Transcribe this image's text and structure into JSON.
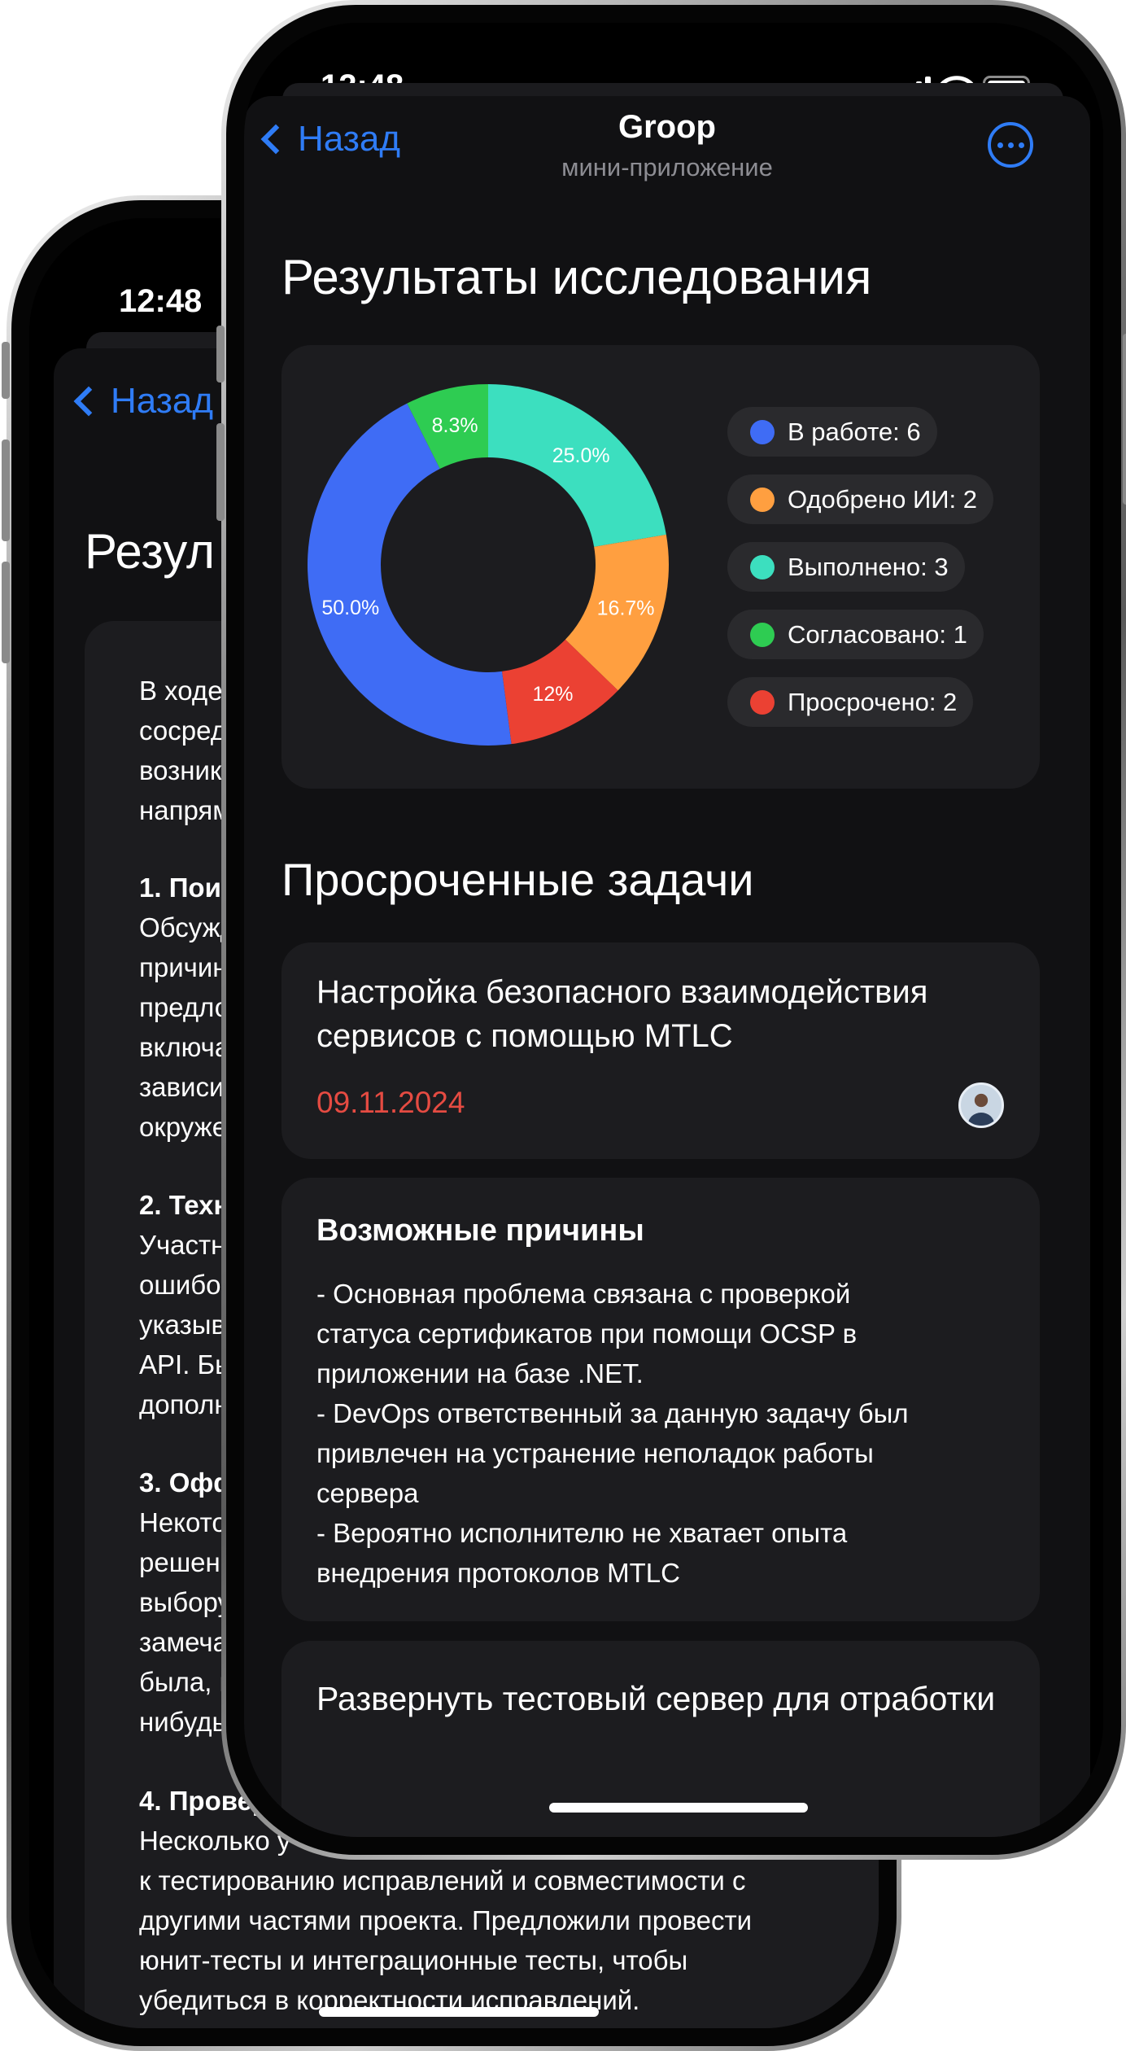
{
  "back_phone": {
    "status_time": "12:48",
    "nav_back_label": "Назад",
    "title_fragment": "Резул",
    "body_lines": {
      "intro": "В ходе о\nсосредо\nвозникл\nнапряму",
      "p1_head": "1. Поиск",
      "p1_body": "Обсужд\nпричина\nпредлож\nвключая\nзависим\nокружен",
      "p2_head": "2. Техни",
      "p2_body": "Участни\nошибок,\nуказыва\nAPI. Был\nдополни",
      "p3_head": "3. Оффт",
      "p3_body": "Некотор\nрешения\nвыбору т\nзамечан\nбыла, но\nнибудь в",
      "p4_head": "4. Провер",
      "p4_body_first": "Несколько у",
      "p4_body_rest": "к тестированию исправлений и совместимости с\nдругими частями проекта. Предложили провести\nюнит-тесты и интеграционные тесты, чтобы\nубедиться в корректности исправлений."
    }
  },
  "front_phone": {
    "status_time": "12:48",
    "nav": {
      "back_label": "Назад",
      "title": "Groop",
      "subtitle": "мини-приложение"
    },
    "results_title": "Результаты исследования",
    "overdue_title": "Просроченные задачи",
    "legend": [
      {
        "label": "В работе: 6",
        "color": "#3f6cf5"
      },
      {
        "label": "Одобрено ИИ: 2",
        "color": "#ff9f40"
      },
      {
        "label": "Выполнено: 3",
        "color": "#3cdfbf"
      },
      {
        "label": "Согласовано: 1",
        "color": "#2ecc52"
      },
      {
        "label": "Просрочено: 2",
        "color": "#eb4133"
      }
    ],
    "task": {
      "title": "Настройка безопасного взаимодействия сервисов с помощью MTLC",
      "date": "09.11.2024"
    },
    "reasons": {
      "title": "Возможные причины",
      "text": "- Основная проблема связана с проверкой\nстатуса сертификатов при помощи OCSP в\nприложении на базе .NET.\n- DevOps ответственный за данную задачу был\nпривлечен на устранение неполадок работы\nсервера\n- Вероятно исполнителю не хватает опыта\nвнедрения протоколов MTLC"
    },
    "next_task_title": "Развернуть тестовый сервер для отработки"
  },
  "chart_data": {
    "type": "pie",
    "donut": true,
    "categories": [
      "В работе",
      "Одобрено ИИ",
      "Выполнено",
      "Согласовано",
      "Просрочено"
    ],
    "counts": [
      6,
      2,
      3,
      1,
      2
    ],
    "segments": [
      {
        "name": "В работе",
        "value": 50.0,
        "label": "50.0%",
        "color": "#3f6cf5"
      },
      {
        "name": "Просрочено",
        "value": 12.0,
        "label": "12%",
        "color": "#eb4133"
      },
      {
        "name": "Одобрено ИИ",
        "value": 16.7,
        "label": "16.7%",
        "color": "#ff9f40"
      },
      {
        "name": "Выполнено",
        "value": 25.0,
        "label": "25.0%",
        "color": "#3cdfbf"
      },
      {
        "name": "Согласовано",
        "value": 8.3,
        "label": "8.3%",
        "color": "#2ecc52"
      }
    ],
    "legend_position": "right"
  }
}
